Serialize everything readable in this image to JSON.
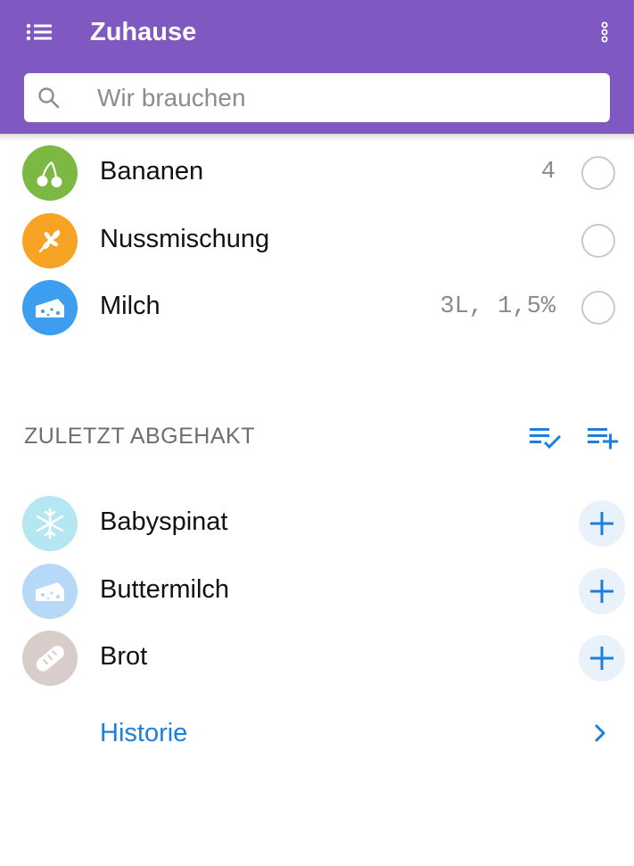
{
  "app_bar": {
    "title": "Zuhause",
    "background": "#7f58c1",
    "menu_icon": "list-menu-icon",
    "more_icon": "more-vertical-icon"
  },
  "search": {
    "placeholder": "Wir brauchen",
    "value": "",
    "icon": "search-icon"
  },
  "shopping_list": [
    {
      "name": "Bananen",
      "quantity": "4",
      "icon": "cherry-icon",
      "color": "#7db842",
      "checked": false
    },
    {
      "name": "Nussmischung",
      "quantity": "",
      "icon": "grain-icon",
      "color": "#f7a425",
      "checked": false
    },
    {
      "name": "Milch",
      "quantity": "3L, 1,5%",
      "icon": "cheese-icon",
      "color": "#3d9ef0",
      "checked": false
    }
  ],
  "recent_section": {
    "title": "ZULETZT ABGEHAKT",
    "actions": [
      "checklist-done-icon",
      "playlist-add-icon"
    ],
    "items": [
      {
        "name": "Babyspinat",
        "icon": "snowflake-icon",
        "color": "#b4e7f2"
      },
      {
        "name": "Buttermilch",
        "icon": "cheese-icon",
        "color": "#b7d9f8"
      },
      {
        "name": "Brot",
        "icon": "bread-icon",
        "color": "#d8cdca"
      }
    ],
    "history_label": "Historie"
  },
  "colors": {
    "accent_blue": "#1c7fe0",
    "add_button_bg": "#e9f1fb"
  }
}
